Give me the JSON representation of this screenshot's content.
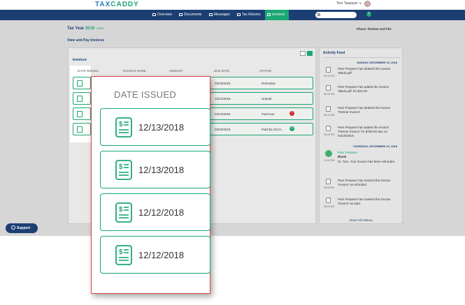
{
  "app": {
    "logo_part1": "TAX",
    "logo_part2": "CADDY"
  },
  "user": {
    "name": "Tom Taxpayer",
    "caret": "∨"
  },
  "nav": {
    "items": [
      {
        "label": "Overview",
        "icon": "home-icon"
      },
      {
        "label": "Documents",
        "icon": "document-icon"
      },
      {
        "label": "Messages",
        "icon": "message-icon"
      },
      {
        "label": "Tax Returns",
        "icon": "tax-return-icon"
      },
      {
        "label": "Invoices",
        "icon": "invoice-icon",
        "active": true
      }
    ],
    "help_label": "?"
  },
  "page": {
    "tax_year_label": "Tax Year",
    "tax_year": "2018",
    "alt_year": "2019",
    "phase": "Phase: Review and File",
    "link": "View and Pay Invoices"
  },
  "invoices": {
    "title": "Invoices",
    "columns": [
      "DATE ISSUED",
      "INVOICE NAME",
      "AMOUNT",
      "DUE DATE",
      "STATUS"
    ],
    "rows": [
      {
        "due_date": "02/03/2018",
        "status": "Refunded",
        "icon": ""
      },
      {
        "due_date": "10/12/2018",
        "status": "Unpaid",
        "icon": ""
      },
      {
        "due_date": "04/10/2018",
        "status": "Past Due",
        "icon": "error"
      },
      {
        "due_date": "02/03/2018",
        "status": "Paid $1,234.0...",
        "icon": "check"
      }
    ]
  },
  "activity": {
    "title": "Activity Feed",
    "date1": "SUNDAY, DECEMBER 16, 2018",
    "date2": "THURSDAY, DECEMBER 13, 2018",
    "entries1": [
      {
        "time": "08:10 PM",
        "text": "Pam Preparer has deleted the invoice 'Blank.pdf'."
      },
      {
        "time": "08:10 PM",
        "text": "Pam Preparer has added the invoice 'Blank.pdf' for $10.00."
      },
      {
        "time": "08:10 PM",
        "text": "Pam Preparer has deleted the invoice 'Partner Invoice'."
      },
      {
        "time": "08:10 PM",
        "text": "Pam Preparer has added the invoice 'Partner Invoice' for $793.00 due on 04/10/2019."
      }
    ],
    "author": "Pam Preparer",
    "author_sub": "Blank",
    "author_msg": "Hi, Tom. Your invoice has been refunded.",
    "author_time": "12:02 PM",
    "entries2": [
      {
        "time": "08:53 AM",
        "text": "Pam Preparer has marked the invoice 'Invoice' as refunded."
      },
      {
        "time": "08:53 AM",
        "text": "Pam Preparer has marked the invoice 'Invoice' as paid."
      }
    ],
    "view_history": "View Full History"
  },
  "support": {
    "label": "Support"
  },
  "zoom": {
    "header": "DATE ISSUED",
    "dates": [
      "12/13/2018",
      "12/13/2018",
      "12/12/2018",
      "12/12/2018"
    ]
  },
  "colors": {
    "navy": "#1c3f73",
    "green": "#1ba774",
    "red": "#d32b2b"
  }
}
